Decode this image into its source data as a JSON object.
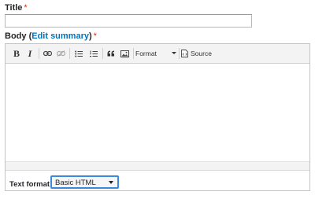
{
  "title_field": {
    "label": "Title",
    "required_mark": "*",
    "value": ""
  },
  "body_field": {
    "label": "Body",
    "open_paren": "(",
    "summary_link": "Edit summary",
    "close_paren": ")",
    "required_mark": "*"
  },
  "toolbar": {
    "bold": "B",
    "italic": "I",
    "format_dropdown": "Format",
    "source": "Source"
  },
  "text_format": {
    "label": "Text format",
    "selected": "Basic HTML"
  }
}
